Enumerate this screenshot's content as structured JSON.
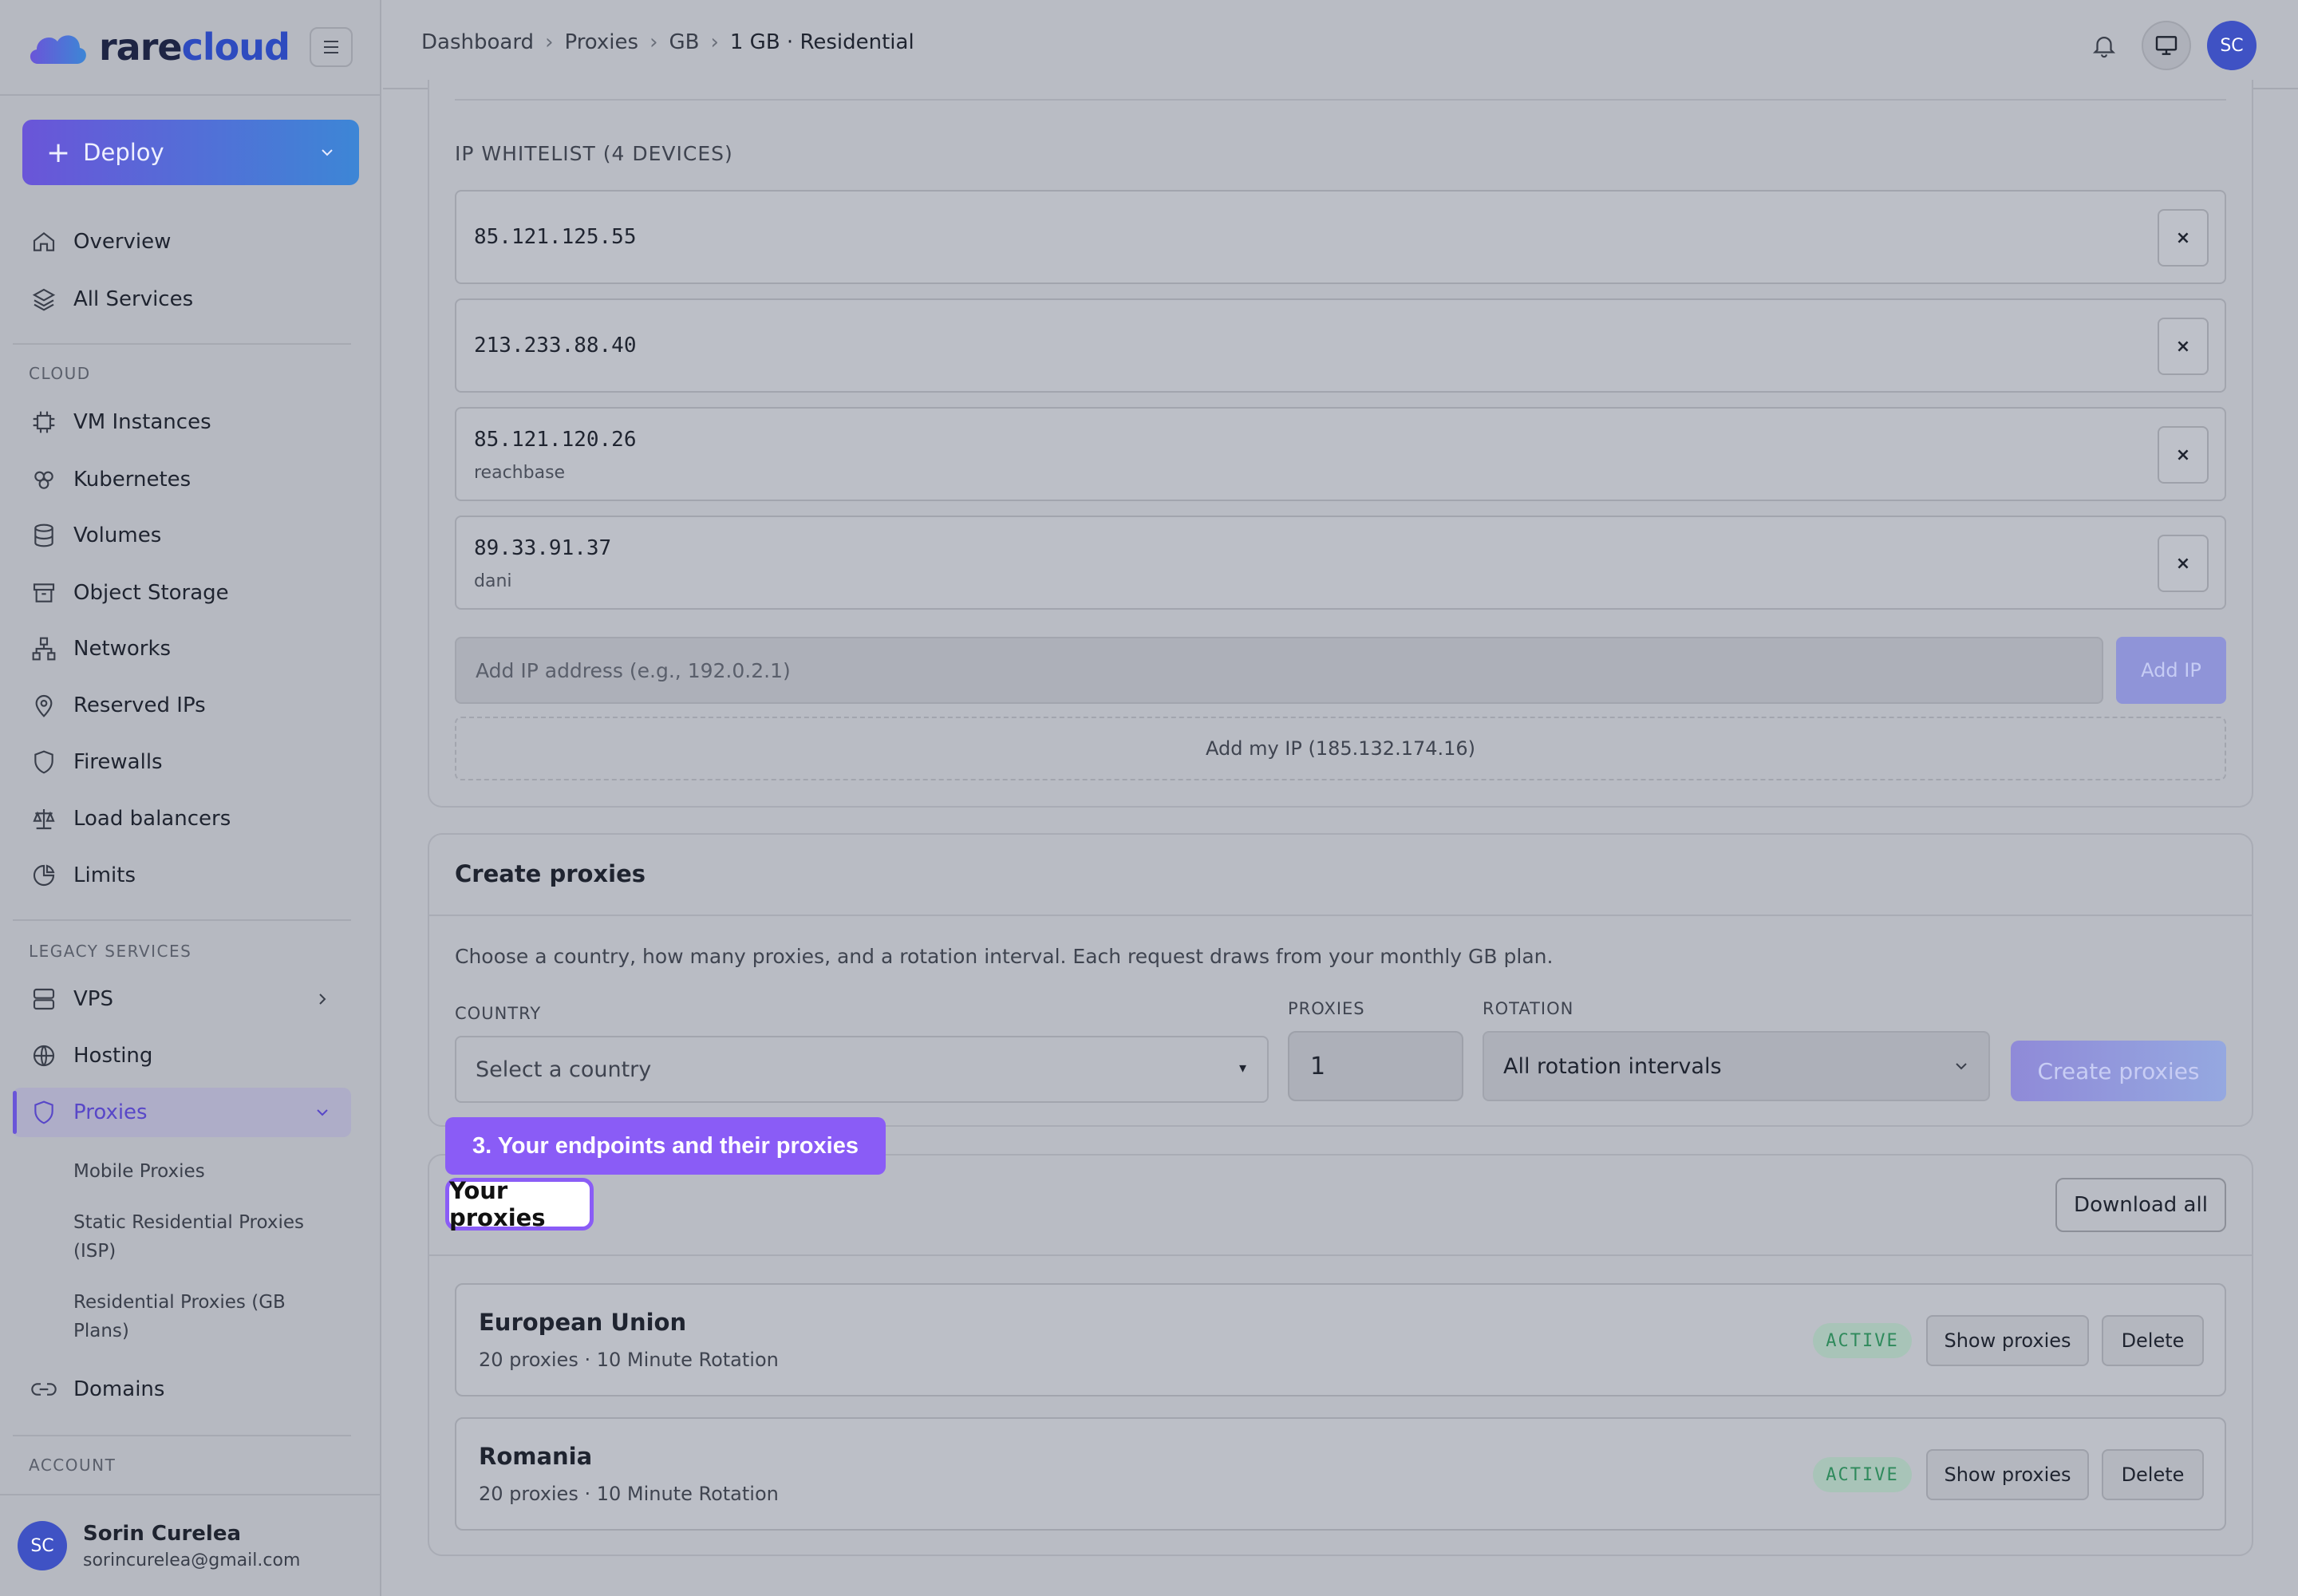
{
  "brand": {
    "name_part1": "rare",
    "name_part2": "cloud"
  },
  "sidebar": {
    "deploy_label": "Deploy",
    "items_top": [
      {
        "label": "Overview",
        "icon": "home-icon"
      },
      {
        "label": "All Services",
        "icon": "layers-icon"
      }
    ],
    "section_cloud": "CLOUD",
    "items_cloud": [
      {
        "label": "VM Instances",
        "icon": "cpu-icon"
      },
      {
        "label": "Kubernetes",
        "icon": "kubernetes-icon"
      },
      {
        "label": "Volumes",
        "icon": "database-icon"
      },
      {
        "label": "Object Storage",
        "icon": "archive-icon"
      },
      {
        "label": "Networks",
        "icon": "network-icon"
      },
      {
        "label": "Reserved IPs",
        "icon": "map-pin-icon"
      },
      {
        "label": "Firewalls",
        "icon": "shield-icon"
      },
      {
        "label": "Load balancers",
        "icon": "scale-icon"
      },
      {
        "label": "Limits",
        "icon": "pie-chart-icon"
      }
    ],
    "section_legacy": "LEGACY SERVICES",
    "items_legacy": [
      {
        "label": "VPS",
        "icon": "server-icon"
      },
      {
        "label": "Hosting",
        "icon": "globe-icon"
      },
      {
        "label": "Proxies",
        "icon": "shield-icon"
      }
    ],
    "proxies_sub": [
      "Mobile Proxies",
      "Static Residential Proxies (ISP)",
      "Residential Proxies (GB Plans)"
    ],
    "domains_label": "Domains",
    "section_account": "ACCOUNT",
    "user": {
      "initials": "SC",
      "name": "Sorin Curelea",
      "email": "sorincurelea@gmail.com"
    }
  },
  "header": {
    "breadcrumb": [
      "Dashboard",
      "Proxies",
      "GB",
      "1 GB · Residential"
    ],
    "avatar_initials": "SC"
  },
  "whitelist": {
    "title": "IP WHITELIST (4 DEVICES)",
    "entries": [
      {
        "ip": "85.121.125.55",
        "label": ""
      },
      {
        "ip": "213.233.88.40",
        "label": ""
      },
      {
        "ip": "85.121.120.26",
        "label": "reachbase"
      },
      {
        "ip": "89.33.91.37",
        "label": "dani"
      }
    ],
    "remove_glyph": "×",
    "input_placeholder": "Add IP address (e.g., 192.0.2.1)",
    "add_button": "Add IP",
    "add_my_ip": "Add my IP (185.132.174.16)"
  },
  "create": {
    "title": "Create proxies",
    "description": "Choose a country, how many proxies, and a rotation interval. Each request draws from your monthly GB plan.",
    "country_label": "COUNTRY",
    "country_placeholder": "Select a country",
    "proxies_label": "PROXIES",
    "proxies_value": "1",
    "rotation_label": "ROTATION",
    "rotation_value": "All rotation intervals",
    "submit": "Create proxies"
  },
  "tour": {
    "tooltip": "3. Your endpoints and their proxies"
  },
  "your_proxies": {
    "title": "Your proxies",
    "download_all": "Download all",
    "endpoints": [
      {
        "name": "European Union",
        "meta": "20 proxies · 10 Minute Rotation",
        "status": "ACTIVE"
      },
      {
        "name": "Romania",
        "meta": "20 proxies · 10 Minute Rotation",
        "status": "ACTIVE"
      }
    ],
    "show_label": "Show proxies",
    "delete_label": "Delete"
  },
  "colors": {
    "accent": "#6a55d8",
    "tour": "#8a5cf6",
    "active": "#2f8a5c"
  }
}
